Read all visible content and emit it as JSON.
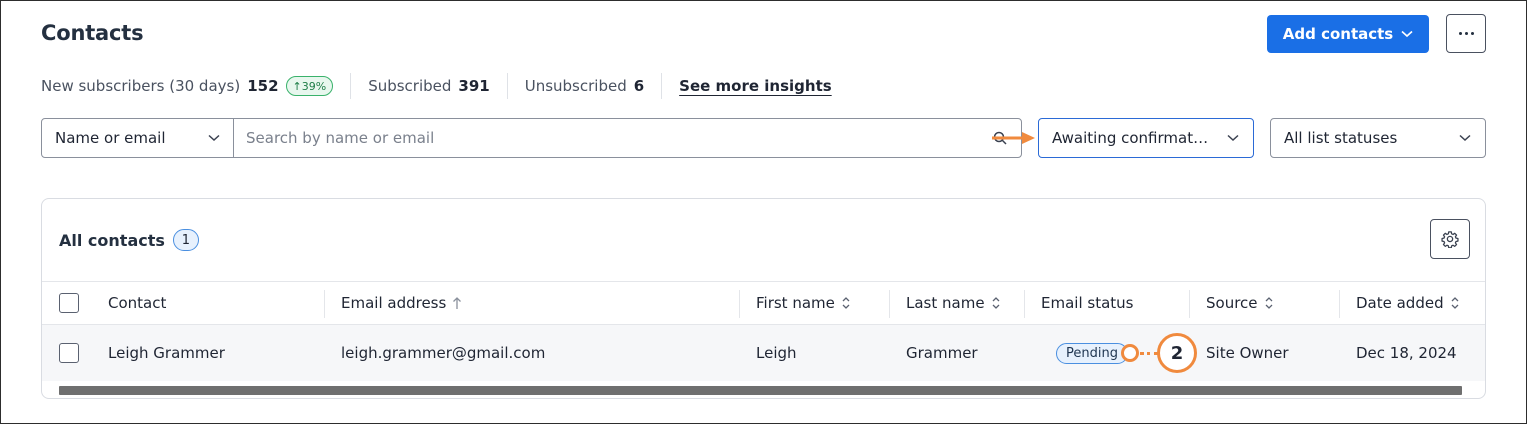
{
  "header": {
    "title": "Contacts",
    "add_contacts_label": "Add contacts",
    "more_label": "More options"
  },
  "stats": {
    "new_label": "New subscribers (30 days)",
    "new_value": "152",
    "new_growth": "↑39%",
    "subscribed_label": "Subscribed",
    "subscribed_value": "391",
    "unsubscribed_label": "Unsubscribed",
    "unsubscribed_value": "6",
    "see_more": "See more insights"
  },
  "filters": {
    "search_field_select": "Name or email",
    "search_placeholder": "Search by name or email",
    "search_value": "",
    "email_status_select": "Awaiting confirmat…",
    "list_status_select": "All list statuses"
  },
  "table": {
    "title": "All contacts",
    "count": "1",
    "columns": [
      {
        "label": "Contact"
      },
      {
        "label": "Email address",
        "sort": "asc"
      },
      {
        "label": "First name",
        "sort": "both"
      },
      {
        "label": "Last name",
        "sort": "both"
      },
      {
        "label": "Email status"
      },
      {
        "label": "Source",
        "sort": "both"
      },
      {
        "label": "Date added",
        "sort": "both"
      }
    ],
    "rows": [
      {
        "contact": "Leigh Grammer",
        "email": "leigh.grammer@gmail.com",
        "first_name": "Leigh",
        "last_name": "Grammer",
        "email_status": "Pending",
        "source": "Site Owner",
        "date_added": "Dec 18, 2024"
      }
    ]
  },
  "annotation": {
    "callout_number": "2",
    "color": "#f08a3e"
  },
  "colors": {
    "primary": "#1a6fe6",
    "growth_green": "#3ab26b",
    "badge_blue": "#4a8fe0"
  }
}
